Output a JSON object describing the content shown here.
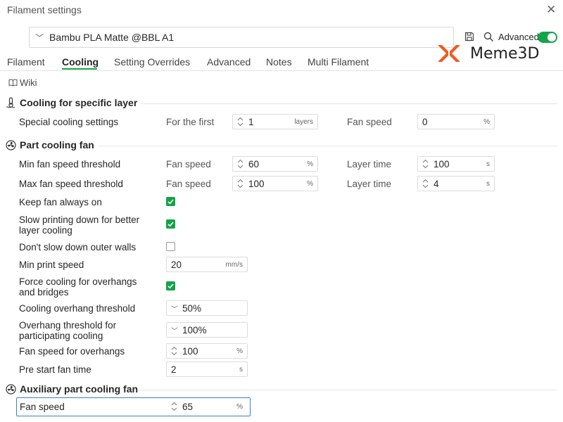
{
  "window": {
    "title": "Filament settings"
  },
  "preset": {
    "name": "Bambu PLA Matte @BBL A1"
  },
  "toolbar": {
    "advanced_label": "Advanced",
    "advanced_on": true
  },
  "logo": {
    "text": "Meme3D"
  },
  "tabs": [
    {
      "label": "Filament"
    },
    {
      "label": "Cooling",
      "active": true
    },
    {
      "label": "Setting Overrides"
    },
    {
      "label": "Advanced"
    },
    {
      "label": "Notes"
    },
    {
      "label": "Multi Filament"
    }
  ],
  "wiki": {
    "label": "Wiki"
  },
  "sections": {
    "specific_layer": {
      "title": "Cooling for specific layer",
      "special": {
        "label": "Special cooling settings",
        "first_label": "For the first",
        "first_value": "1",
        "first_unit": "layers",
        "fan_label": "Fan speed",
        "fan_value": "0",
        "fan_unit": "%"
      }
    },
    "part_cooling": {
      "title": "Part cooling fan",
      "min_fan": {
        "label": "Min fan speed threshold",
        "fan_label": "Fan speed",
        "fan_value": "60",
        "fan_unit": "%",
        "time_label": "Layer time",
        "time_value": "100",
        "time_unit": "s"
      },
      "max_fan": {
        "label": "Max fan speed threshold",
        "fan_label": "Fan speed",
        "fan_value": "100",
        "fan_unit": "%",
        "time_label": "Layer time",
        "time_value": "4",
        "time_unit": "s"
      },
      "keep_fan": {
        "label": "Keep fan always on",
        "checked": true
      },
      "slow_printing": {
        "label_1": "Slow printing down for better",
        "label_2": "layer cooling",
        "checked": true
      },
      "dont_slow": {
        "label": "Don't slow down outer walls",
        "checked": false
      },
      "min_print_speed": {
        "label": "Min print speed",
        "value": "20",
        "unit": "mm/s"
      },
      "force_cooling": {
        "label_1": "Force cooling for overhangs",
        "label_2": "and bridges",
        "checked": true
      },
      "overhang_threshold": {
        "label": "Cooling overhang threshold",
        "value": "50%"
      },
      "overhang_participating": {
        "label_1": "Overhang threshold for",
        "label_2": "participating cooling",
        "value": "100%"
      },
      "fan_overhangs": {
        "label": "Fan speed for overhangs",
        "value": "100",
        "unit": "%"
      },
      "pre_start": {
        "label": "Pre start fan time",
        "value": "2",
        "unit": "s"
      }
    },
    "auxiliary": {
      "title": "Auxiliary part cooling fan",
      "fan_speed": {
        "label": "Fan speed",
        "value": "65",
        "unit": "%"
      }
    }
  },
  "colors": {
    "accent": "#14a34a",
    "focus": "#3b82c4",
    "logo_orange": "#f05a23"
  }
}
